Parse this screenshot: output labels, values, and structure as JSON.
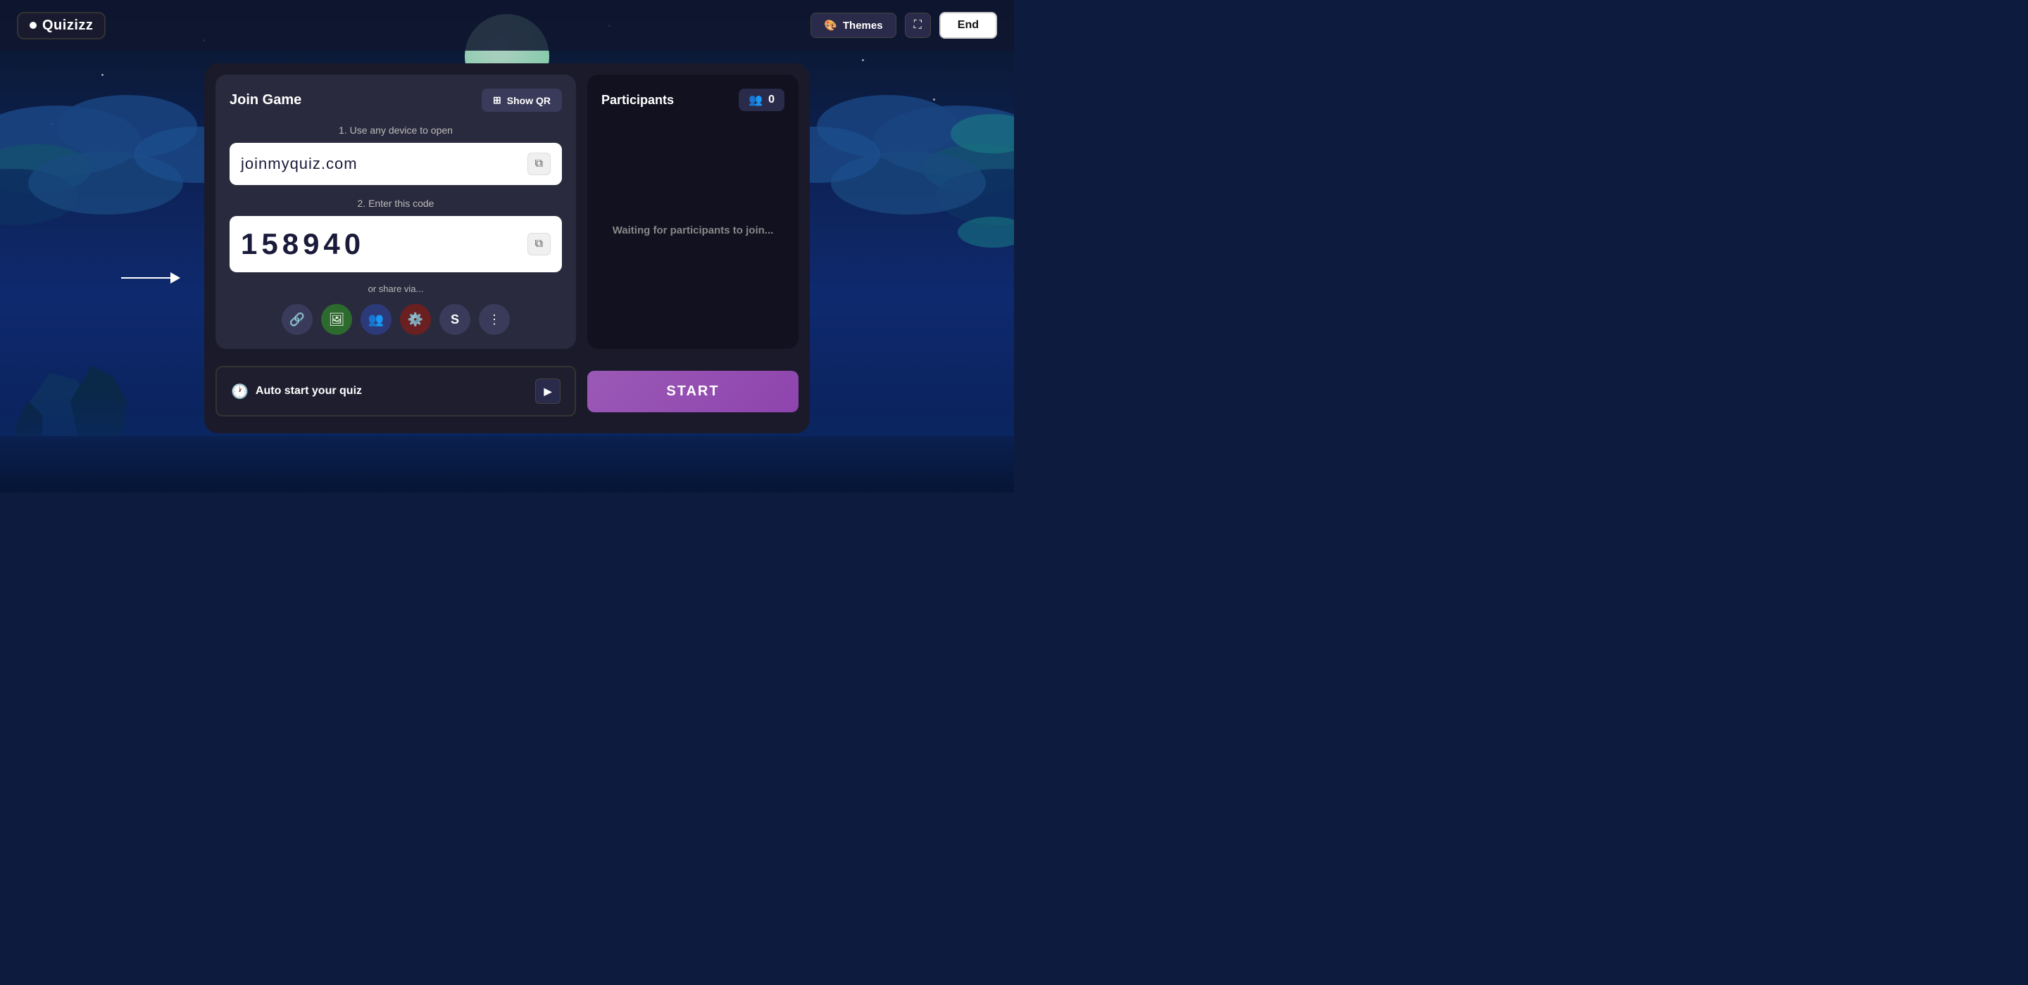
{
  "logo": {
    "text": "Quizizz"
  },
  "topbar": {
    "themes_label": "Themes",
    "end_label": "End"
  },
  "join_game": {
    "title": "Join Game",
    "show_qr_label": "Show QR",
    "step1_label": "1. Use any device to open",
    "url": "joinmyquiz.com",
    "step2_label": "2. Enter this code",
    "code": "158940",
    "share_label": "or share via...",
    "share_icons": [
      "🔗",
      "🖼",
      "👥",
      "⚙️",
      "S",
      "⋮"
    ]
  },
  "participants": {
    "title": "Participants",
    "count": "0",
    "waiting_text": "Waiting for participants to join..."
  },
  "bottom": {
    "auto_start_label": "Auto start your quiz",
    "start_label": "START"
  }
}
